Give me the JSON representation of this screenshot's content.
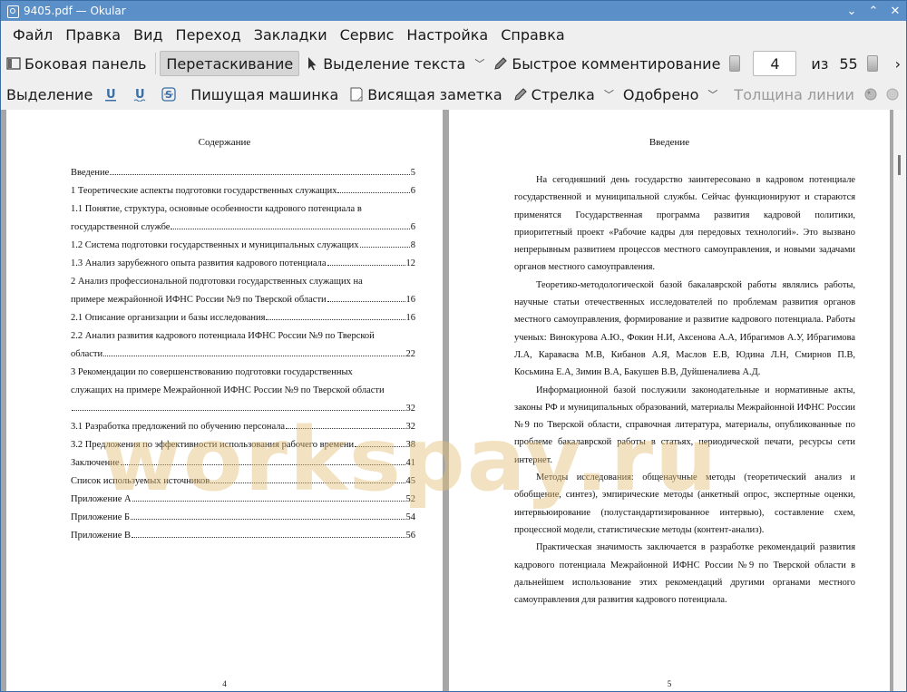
{
  "window": {
    "title": "9405.pdf  — Okular",
    "controls": [
      "⌄",
      "⌃",
      "✕"
    ]
  },
  "menu": [
    "Файл",
    "Правка",
    "Вид",
    "Переход",
    "Закладки",
    "Сервис",
    "Настройка",
    "Справка"
  ],
  "toolbar1": {
    "sidebar": "Боковая панель",
    "drag": "Перетаскивание",
    "text_select": "Выделение текста",
    "quick_annot": "Быстрое комментирование",
    "page_current": "4",
    "page_of": "из",
    "page_total": "55",
    "more": "›"
  },
  "toolbar2": {
    "highlight": "Выделение",
    "typewriter": "Пишущая машинка",
    "note": "Висящая заметка",
    "arrow": "Стрелка",
    "stamp": "Одобрено",
    "line_width": "Толщина линии",
    "more": "›"
  },
  "left_page": {
    "heading": "Содержание",
    "toc": [
      {
        "text": "Введение",
        "page": "5"
      },
      {
        "text": "1 Теоретические аспекты подготовки государственных служащих",
        "page": "6"
      },
      {
        "line1": "1.1 Понятие, структура, основные особенности кадрового потенциала в",
        "text": "государственной службе",
        "page": "6"
      },
      {
        "text": "1.2 Система подготовки государственных и муниципальных служащих",
        "page": "8"
      },
      {
        "text": "1.3 Анализ зарубежного опыта развития кадрового потенциала",
        "page": "12"
      },
      {
        "line1": "2 Анализ профессиональной подготовки государственных служащих на",
        "text": "примере межрайонной ИФНС России №9 по Тверской области",
        "page": "16"
      },
      {
        "text": "2.1 Описание организации и базы исследования",
        "page": "16"
      },
      {
        "line1": "2.2 Анализ развития кадрового потенциала ИФНС России №9 по Тверской",
        "text": "области",
        "page": "22"
      },
      {
        "line1": "3 Рекомендации по совершенствованию подготовки государственных",
        "line2": "служащих на примере Межрайонной ИФНС России №9 по Тверской области",
        "text": "",
        "page": "32"
      },
      {
        "text": "3.1 Разработка предложений по обучению персонала",
        "page": "32"
      },
      {
        "text": "3.2 Предложения по эффективности использования рабочего времени",
        "page": "38"
      },
      {
        "text": "Заключение",
        "page": "41"
      },
      {
        "text": "Список используемых источников",
        "page": "45"
      },
      {
        "text": "Приложение А",
        "page": "52"
      },
      {
        "text": "Приложение Б",
        "page": "54"
      },
      {
        "text": "Приложение В",
        "page": "56"
      }
    ],
    "page_number": "4"
  },
  "right_page": {
    "heading": "Введение",
    "paragraphs": [
      "На сегодняшний день государство заинтересовано в кадровом потенциале государственной и муниципальной службы. Сейчас функционируют и стараются применятся Государственная программа развития кадровой политики, приоритетный проект «Рабочие кадры для передовых технологий». Это вызвано непрерывным развитием процессов местного самоуправления, и новыми задачами органов местного самоуправления.",
      "Теоретико-методологической базой бакалаврской работы являлись работы, научные статьи отечественных исследователей по проблемам развития органов местного самоуправления, формирование и развитие кадрового потенциала. Работы ученых: Винокурова А.Ю., Фокин Н.И, Аксенова А.А, Ибрагимов А.У, Ибрагимова Л.А, Каравасва М.В, Кибанов А.Я, Маслов Е.В, Юдина Л.Н, Смирнов П.В, Косьмина Е.А, Зимин В.А, Бакушев В.В, Дуйшеналиева А.Д.",
      "Информационной базой послужили законодательные и нормативные акты, законы РФ и муниципальных образований, материалы Межрайонной ИФНС России №9 по Тверской области, справочная литература, материалы, опубликованные по проблеме бакалаврской работы в статьях, периодической печати, ресурсы сети интернет.",
      "Методы исследования: общенаучные методы (теоретический анализ и обобщение, синтез), эмпирические методы (анкетный опрос, экспертные оценки, интервьюирование (полустандартизированное интервью), составление схем, процессной модели, статистические методы (контент-анализ).",
      "Практическая значимость заключается в разработке рекомендаций развития кадрового потенциала Межрайонной ИФНС России №9 по Тверской области в дальнейшем использование этих рекомендаций другими органами местного самоуправления для развития кадрового потенциала."
    ],
    "page_number": "5"
  },
  "watermark": "workspay.ru"
}
